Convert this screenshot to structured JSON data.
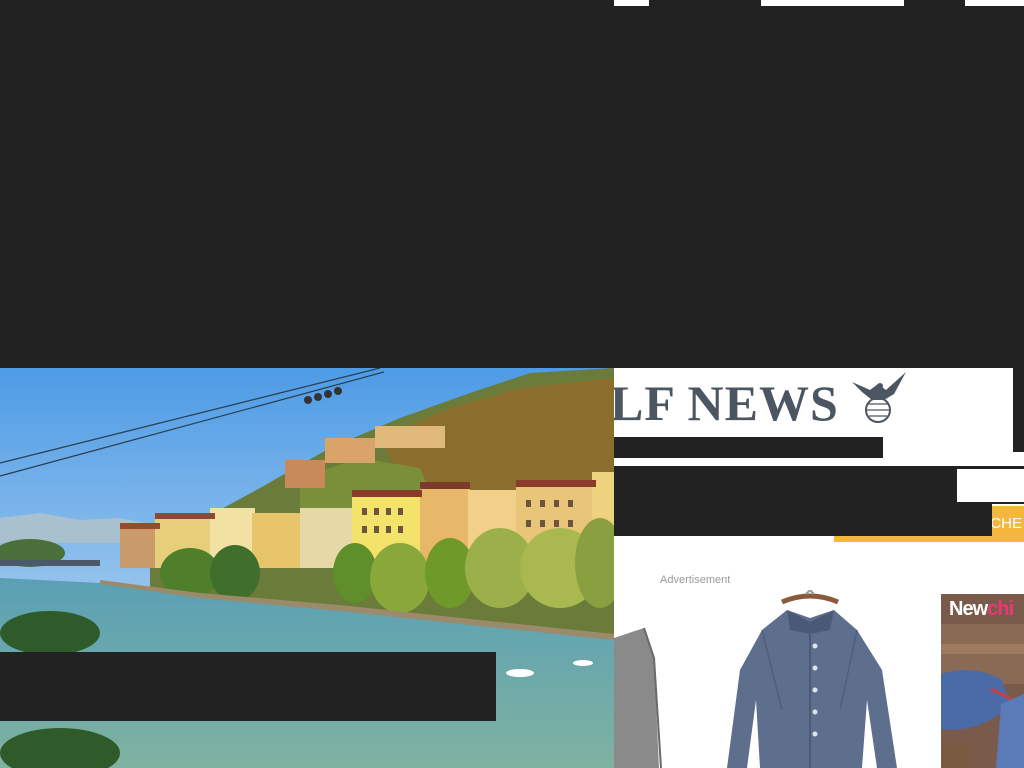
{
  "news_site": {
    "logo_text": "LF NEWS",
    "nav_tab_partial": "ACHE",
    "advertisement_label": "Advertisement",
    "ad_brand": {
      "part1": "New",
      "part2": "chi"
    }
  },
  "colors": {
    "background": "#222222",
    "logo": "#4b5662",
    "nav_accent": "#f3b63f",
    "brand_pink": "#e83a7a"
  }
}
